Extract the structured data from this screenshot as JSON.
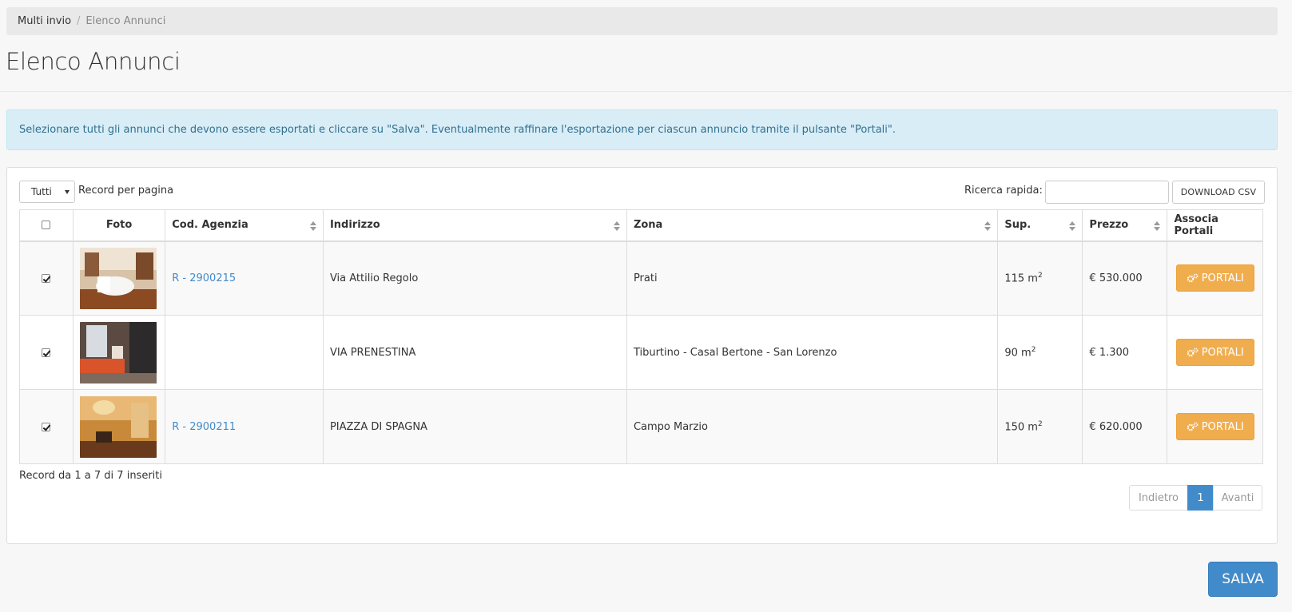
{
  "breadcrumb": {
    "parent": "Multi invio",
    "current": "Elenco Annunci"
  },
  "page_title": "Elenco Annunci",
  "alert_text": "Selezionare tutti gli annunci che devono essere esportati e cliccare su \"Salva\". Eventualmente raffinare l'esportazione per ciascun annuncio tramite il pulsante \"Portali\".",
  "controls": {
    "length_value": "Tutti",
    "length_label": "Record per pagina",
    "search_label": "Ricerca rapida:",
    "search_value": "",
    "csv_label": "DOWNLOAD CSV"
  },
  "table": {
    "headers": {
      "foto": "Foto",
      "cod": "Cod. Agenzia",
      "indirizzo": "Indirizzo",
      "zona": "Zona",
      "sup": "Sup.",
      "prezzo": "Prezzo",
      "portali": "Associa Portali"
    },
    "rows": [
      {
        "checked": true,
        "cod": "R - 2900215",
        "indirizzo": "Via Attilio Regolo",
        "zona": "Prati",
        "sup": "115 m",
        "sup_unit": "2",
        "prezzo": "€ 530.000",
        "button": "PORTALI"
      },
      {
        "checked": true,
        "cod": "",
        "indirizzo": "VIA PRENESTINA",
        "zona": "Tiburtino - Casal Bertone - San Lorenzo",
        "sup": "90 m",
        "sup_unit": "2",
        "prezzo": "€ 1.300",
        "button": "PORTALI"
      },
      {
        "checked": true,
        "cod": "R - 2900211",
        "indirizzo": "PIAZZA DI SPAGNA",
        "zona": "Campo Marzio",
        "sup": "150 m",
        "sup_unit": "2",
        "prezzo": "€ 620.000",
        "button": "PORTALI"
      }
    ]
  },
  "info_text": "Record da 1 a 7 di 7 inseriti",
  "pagination": {
    "prev": "Indietro",
    "current": "1",
    "next": "Avanti"
  },
  "save_label": "SALVA",
  "colors": {
    "primary": "#428bca",
    "warning": "#f0ad4e",
    "info_bg": "#d9edf7",
    "info_text": "#31708f"
  }
}
